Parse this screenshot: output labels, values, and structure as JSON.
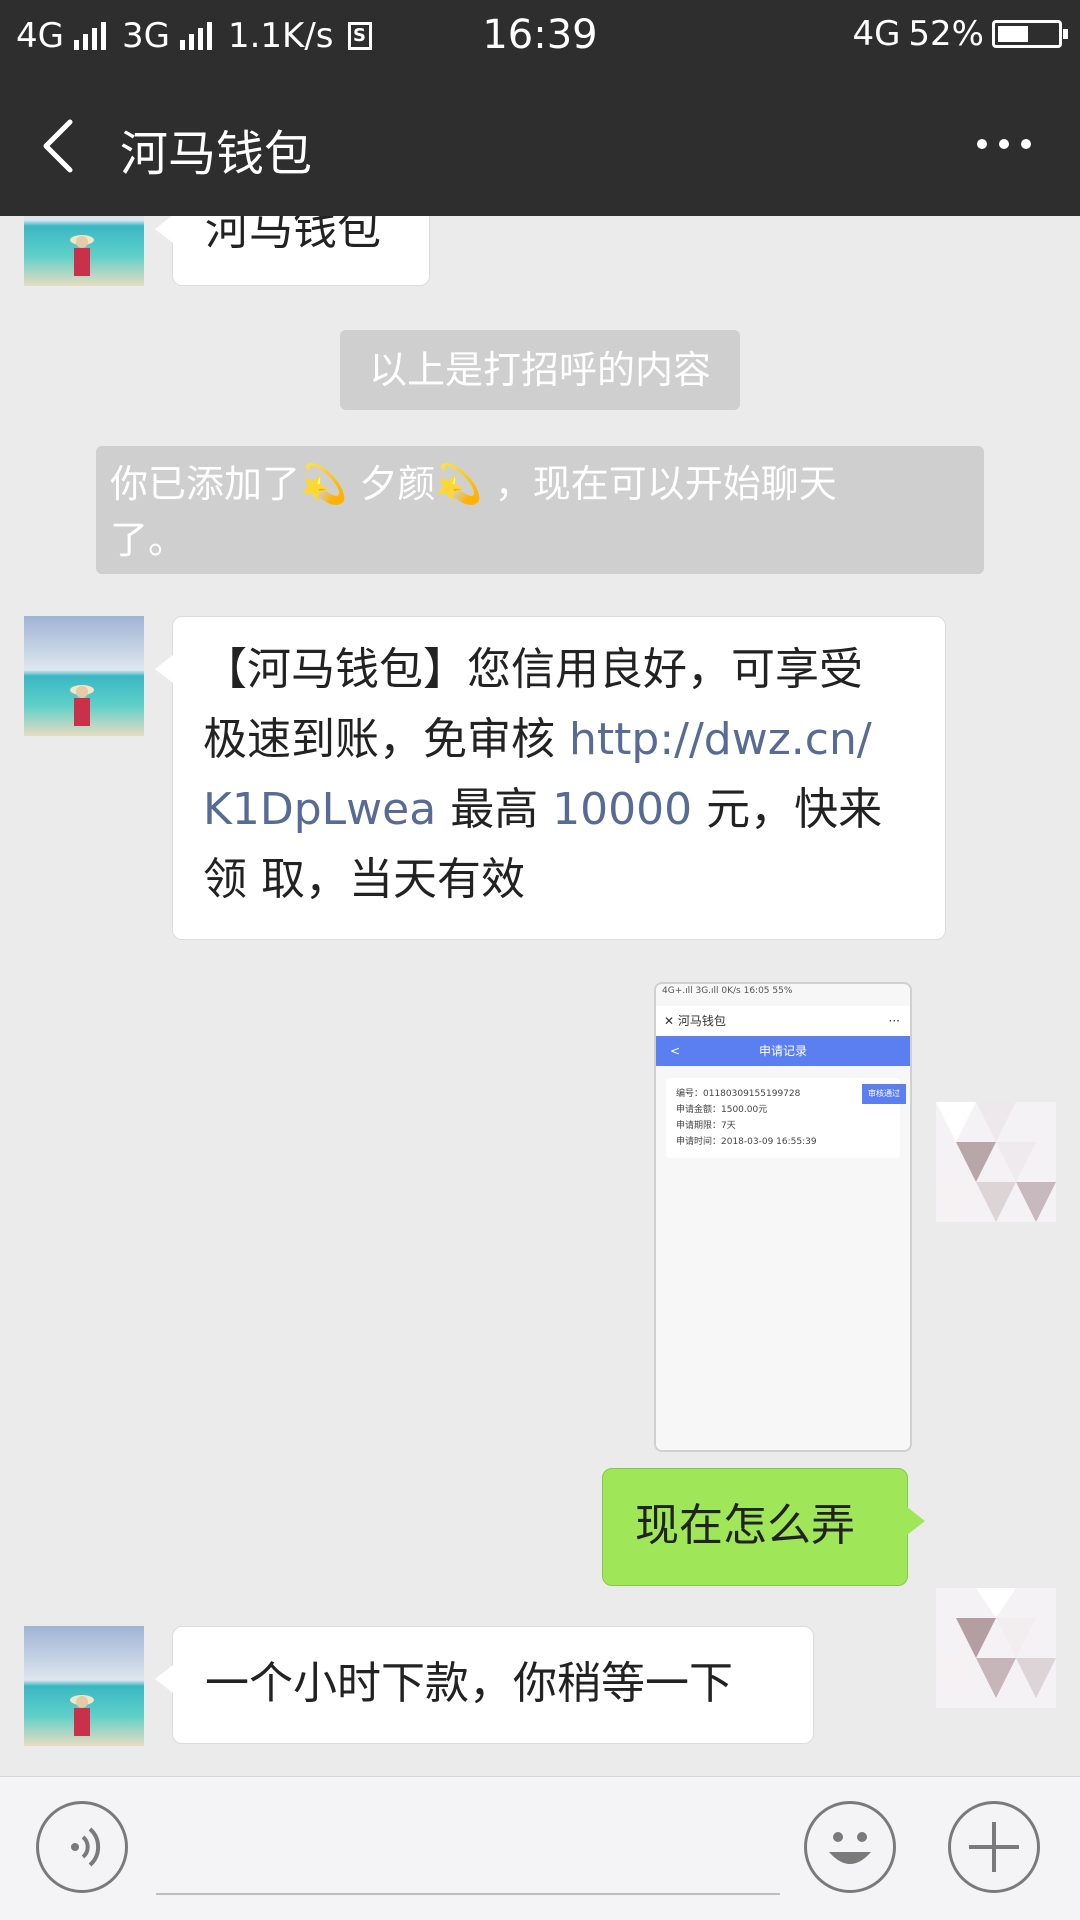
{
  "status_bar": {
    "network1": "4G",
    "network2": "3G",
    "speed": "1.1K/s",
    "time": "16:39",
    "network_right": "4G",
    "battery_percent": "52%",
    "battery_level": 0.52
  },
  "header": {
    "title": "河马钱包"
  },
  "messages": {
    "partial_top": "河马钱包",
    "greeting_note": "以上是打招呼的内容",
    "added_note_line1": "你已添加了💫 夕颜💫 ，现在可以开始聊天",
    "added_note_line2": "了。",
    "ad_line1": "【河马钱包】您信用良好，可享受",
    "ad_line2_text": "极速到账，免审核 ",
    "ad_line2_link": "http://dwz.cn/",
    "ad_line3_link": "K1DpLwea",
    "ad_line3_a": " 最高 ",
    "ad_line3_num": "10000",
    "ad_line3_b": " 元，快来",
    "ad_line4": "领 取，当天有效",
    "reply_self": "现在怎么弄",
    "reply_other": "一个小时下款，你稍等一下"
  },
  "screenshot_image": {
    "status": "4G+.ıll 3G.ıll 0K/s   16:05   55%",
    "title": "河马钱包",
    "more": "···",
    "bar_title": "申请记录",
    "tag": "审核通过",
    "rows": [
      "编号：01180309155199728",
      "申请金额：1500.00元",
      "申请期限：7天",
      "申请时间：2018-03-09 16:55:39"
    ]
  },
  "colors": {
    "header_bg": "#2e2e2e",
    "chat_bg": "#ebebeb",
    "self_bubble": "#9fe658",
    "link": "#576b95"
  }
}
